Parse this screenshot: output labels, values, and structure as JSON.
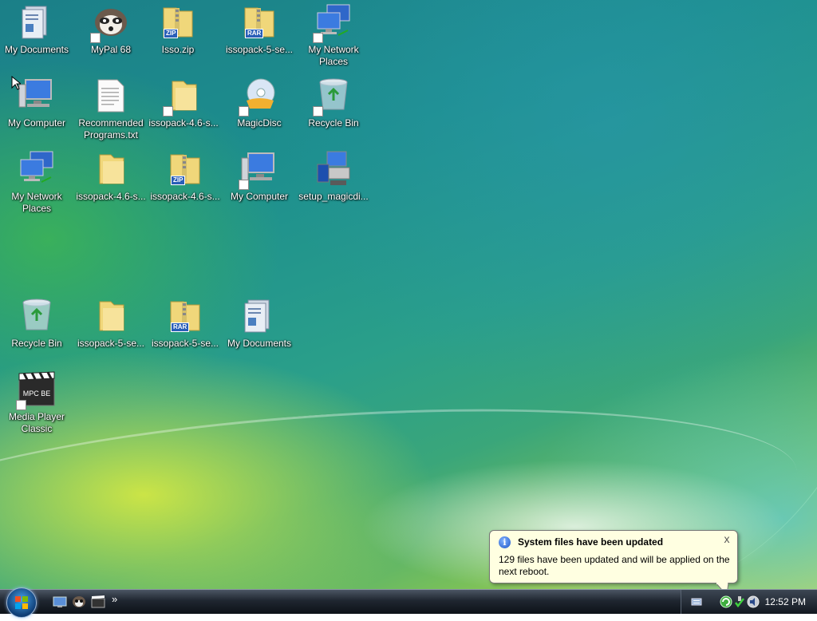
{
  "desktop": {
    "icons": [
      {
        "label": "My Documents",
        "kind": "documents"
      },
      {
        "label": "MyPal 68",
        "kind": "raccoon"
      },
      {
        "label": "Isso.zip",
        "kind": "zip-folder"
      },
      {
        "label": "issopack-5-se...",
        "kind": "rar-folder"
      },
      {
        "label": "My Network Places",
        "kind": "network"
      },
      {
        "label": "My Computer",
        "kind": "computer"
      },
      {
        "label": "Recommended Programs.txt",
        "kind": "text-file"
      },
      {
        "label": "issopack-4.6-s...",
        "kind": "folder-shortcut"
      },
      {
        "label": "MagicDisc",
        "kind": "disc"
      },
      {
        "label": "Recycle Bin",
        "kind": "recycle-bin"
      },
      {
        "label": "My Network Places",
        "kind": "network"
      },
      {
        "label": "issopack-4.6-s...",
        "kind": "folder"
      },
      {
        "label": "issopack-4.6-s...",
        "kind": "zip-folder"
      },
      {
        "label": "My Computer",
        "kind": "computer"
      },
      {
        "label": "setup_magicdi...",
        "kind": "installer"
      },
      {
        "label": "Recycle Bin",
        "kind": "recycle-bin"
      },
      {
        "label": "issopack-5-se...",
        "kind": "folder"
      },
      {
        "label": "issopack-5-se...",
        "kind": "rar-folder"
      },
      {
        "label": "My Documents",
        "kind": "documents"
      },
      {
        "label": "Media Player Classic",
        "kind": "media-player"
      }
    ],
    "badges": {
      "zip": "ZIP",
      "rar": "RAR",
      "mpc": "MPC BE"
    }
  },
  "notification": {
    "title": "System files have been updated",
    "body": "129 files have been updated and will be applied on the next reboot.",
    "close": "x",
    "info_glyph": "i"
  },
  "taskbar": {
    "quick_launch": [
      "show-desktop-icon",
      "mypal-icon",
      "media-player-icon"
    ],
    "chevron": "»",
    "clock": "12:52 PM"
  }
}
